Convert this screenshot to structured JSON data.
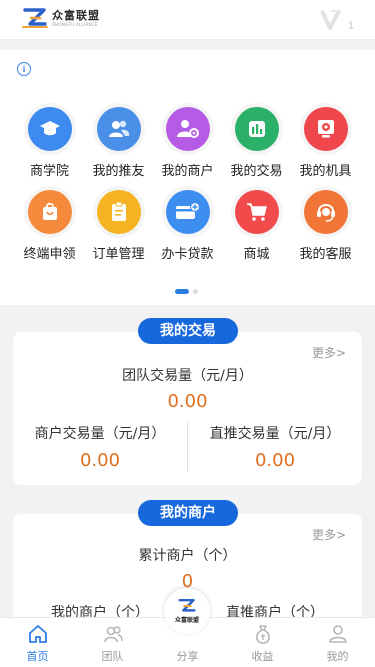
{
  "header": {
    "brand": "众富联盟",
    "brand_sub": "ZHONGFU ALLIANCE",
    "vip_level": "1"
  },
  "menu": {
    "items": [
      {
        "label": "商学院",
        "icon": "graduation-cap-icon",
        "color": "#3d8bf0"
      },
      {
        "label": "我的推友",
        "icon": "friends-icon",
        "color": "#4a90e8"
      },
      {
        "label": "我的商户",
        "icon": "merchant-settings-icon",
        "color": "#b65be6"
      },
      {
        "label": "我的交易",
        "icon": "bar-chart-icon",
        "color": "#2bb06a"
      },
      {
        "label": "我的机具",
        "icon": "device-icon",
        "color": "#f0474c"
      },
      {
        "label": "终端申领",
        "icon": "bag-icon",
        "color": "#f58a3c"
      },
      {
        "label": "订单管理",
        "icon": "clipboard-icon",
        "color": "#f5b323"
      },
      {
        "label": "办卡贷款",
        "icon": "card-plus-icon",
        "color": "#3e8ef0"
      },
      {
        "label": "商城",
        "icon": "cart-icon",
        "color": "#f04a4a"
      },
      {
        "label": "我的客服",
        "icon": "headset-icon",
        "color": "#f27538"
      }
    ]
  },
  "transactions": {
    "title": "我的交易",
    "more": "更多>",
    "team_label": "团队交易量（元/月）",
    "team_value": "0.00",
    "merchant_label": "商户交易量（元/月）",
    "merchant_value": "0.00",
    "direct_label": "直推交易量（元/月）",
    "direct_value": "0.00"
  },
  "merchants": {
    "title": "我的商户",
    "more": "更多>",
    "total_label": "累计商户（个）",
    "total_value": "0",
    "mine_label": "我的商户（个）",
    "direct_label": "直推商户（个）"
  },
  "tabbar": {
    "tabs": [
      {
        "label": "首页",
        "active": true
      },
      {
        "label": "团队",
        "active": false
      },
      {
        "label": "分享",
        "active": false
      },
      {
        "label": "收益",
        "active": false
      },
      {
        "label": "我的",
        "active": false
      }
    ],
    "center_text": "众富联盟"
  },
  "colors": {
    "accent": "#2b7de3",
    "pill": "#1768dd",
    "value": "#e0701f"
  }
}
